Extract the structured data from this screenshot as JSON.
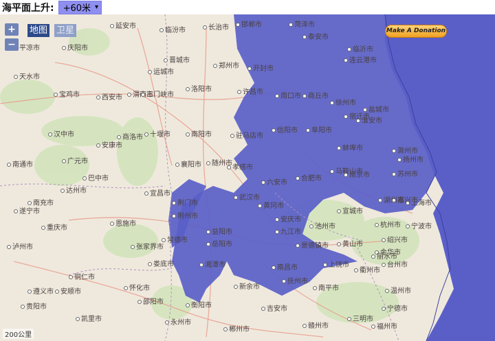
{
  "header": {
    "label": "海平面上升:",
    "selected_level": "+60米"
  },
  "map": {
    "type_buttons": {
      "map": "地图",
      "satellite": "卫星"
    },
    "zoom_in": "+",
    "zoom_out": "−",
    "donate_label": "Make A Donation",
    "scale_label": "200公里",
    "flood_color": "#5a5fc8",
    "sea_color": "#5a5fc8",
    "land_color": "#efe9dd",
    "cities": [
      {
        "name": "延安市"
      },
      {
        "name": "临汾市"
      },
      {
        "name": "长治市"
      },
      {
        "name": "邯郸市"
      },
      {
        "name": "菏泽市"
      },
      {
        "name": "平凉市"
      },
      {
        "name": "庆阳市"
      },
      {
        "name": "运城市"
      },
      {
        "name": "晋城市"
      },
      {
        "name": "郑州市"
      },
      {
        "name": "开封市"
      },
      {
        "name": "泰安市"
      },
      {
        "name": "临沂市"
      },
      {
        "name": "连云港市"
      },
      {
        "name": "天水市"
      },
      {
        "name": "宝鸡市"
      },
      {
        "name": "西安市"
      },
      {
        "name": "渭南市"
      },
      {
        "name": "三门峡市"
      },
      {
        "name": "洛阳市"
      },
      {
        "name": "许昌市"
      },
      {
        "name": "周口市"
      },
      {
        "name": "商丘市"
      },
      {
        "name": "徐州市"
      },
      {
        "name": "宿迁市"
      },
      {
        "name": "淮安市"
      },
      {
        "name": "盐城市"
      },
      {
        "name": "汉中市"
      },
      {
        "name": "安康市"
      },
      {
        "name": "商洛市"
      },
      {
        "name": "十堰市"
      },
      {
        "name": "南阳市"
      },
      {
        "name": "驻马店市"
      },
      {
        "name": "信阳市"
      },
      {
        "name": "阜阳市"
      },
      {
        "name": "蚌埠市"
      },
      {
        "name": "滁州市"
      },
      {
        "name": "扬州市"
      },
      {
        "name": "南通市"
      },
      {
        "name": "广元市"
      },
      {
        "name": "巴中市"
      },
      {
        "name": "达州市"
      },
      {
        "name": "襄阳市"
      },
      {
        "name": "随州市"
      },
      {
        "name": "孝感市"
      },
      {
        "name": "六安市"
      },
      {
        "name": "合肥市"
      },
      {
        "name": "马鞍山市"
      },
      {
        "name": "南京市"
      },
      {
        "name": "苏州市"
      },
      {
        "name": "上海市"
      },
      {
        "name": "南充市"
      },
      {
        "name": "宜昌市"
      },
      {
        "name": "荆门市"
      },
      {
        "name": "武汉市"
      },
      {
        "name": "黄冈市"
      },
      {
        "name": "安庆市"
      },
      {
        "name": "池州市"
      },
      {
        "name": "宣城市"
      },
      {
        "name": "湖州市"
      },
      {
        "name": "嘉兴市"
      },
      {
        "name": "遂宁市"
      },
      {
        "name": "重庆市"
      },
      {
        "name": "恩施市"
      },
      {
        "name": "荆州市"
      },
      {
        "name": "岳阳市"
      },
      {
        "name": "九江市"
      },
      {
        "name": "景德镇市"
      },
      {
        "name": "黄山市"
      },
      {
        "name": "杭州市"
      },
      {
        "name": "绍兴市"
      },
      {
        "name": "宁波市"
      },
      {
        "name": "泸州市"
      },
      {
        "name": "张家界市"
      },
      {
        "name": "常德市"
      },
      {
        "name": "益阳市"
      },
      {
        "name": "南昌市"
      },
      {
        "name": "上饶市"
      },
      {
        "name": "衢州市"
      },
      {
        "name": "金华市"
      },
      {
        "name": "遵义市"
      },
      {
        "name": "铜仁市"
      },
      {
        "name": "怀化市"
      },
      {
        "name": "娄底市"
      },
      {
        "name": "湘潭市"
      },
      {
        "name": "新余市"
      },
      {
        "name": "抚州市"
      },
      {
        "name": "丽水市"
      },
      {
        "name": "台州市"
      },
      {
        "name": "贵阳市"
      },
      {
        "name": "凯里市"
      },
      {
        "name": "邵阳市"
      },
      {
        "name": "衡阳市"
      },
      {
        "name": "吉安市"
      },
      {
        "name": "南平市"
      },
      {
        "name": "温州市"
      },
      {
        "name": "安顺市"
      },
      {
        "name": "永州市"
      },
      {
        "name": "郴州市"
      },
      {
        "name": "赣州市"
      },
      {
        "name": "三明市"
      },
      {
        "name": "宁德市"
      },
      {
        "name": "福州市"
      }
    ]
  }
}
